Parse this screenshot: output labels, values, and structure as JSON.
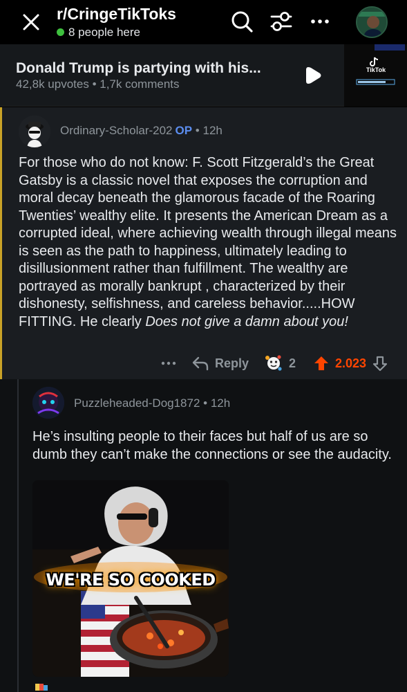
{
  "header": {
    "subreddit": "r/CringeTikToks",
    "presence": "8 people here",
    "presence_color": "#3ec03e"
  },
  "post": {
    "title": "Donald Trump is partying with his...",
    "meta": "42,8k upvotes • 1,7k comments",
    "thumbnail_label": "TikTok"
  },
  "op_comment": {
    "author": "Ordinary-Scholar-202",
    "op_tag": "OP",
    "time": "12h",
    "body_plain": "For those who do not know: F. Scott Fitzgerald’s the Great Gatsby is a classic novel that exposes the corruption and moral decay beneath the glamorous facade of the Roaring Twenties’ wealthy elite. It presents the American Dream as a corrupted ideal, where achieving wealth through illegal means is seen as the path to happiness, ultimately leading to disillusionment rather than fulfillment. The wealthy are portrayed as morally bankrupt , characterized by their dishonesty, selfishness, and careless behavior.....HOW FITTING. He clearly ",
    "body_italic": "Does not give a damn about you!",
    "reply_label": "Reply",
    "award_count": "2",
    "score": "2.023",
    "score_color": "#ff4500",
    "accent_color": "#c9a227"
  },
  "reply_comment": {
    "author": "Puzzleheaded-Dog1872",
    "time": "12h",
    "body": "He’s insulting people to their faces but half of us are so dumb they can’t make the connections or see the audacity.",
    "gif_caption": "WE'RE SO COOKED"
  }
}
